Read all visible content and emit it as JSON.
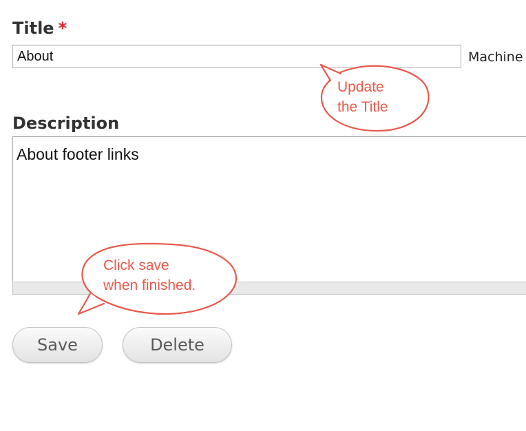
{
  "form": {
    "title_label": "Title",
    "required_marker": "*",
    "title_value": "About",
    "machine_name_label": "Machine",
    "description_label": "Description",
    "description_value": "About footer links"
  },
  "buttons": {
    "save_label": "Save",
    "delete_label": "Delete"
  },
  "annotations": {
    "title_hint": [
      "Update",
      "the Title"
    ],
    "save_hint": [
      "Click save",
      "when finished."
    ],
    "color": "#e8594b"
  }
}
